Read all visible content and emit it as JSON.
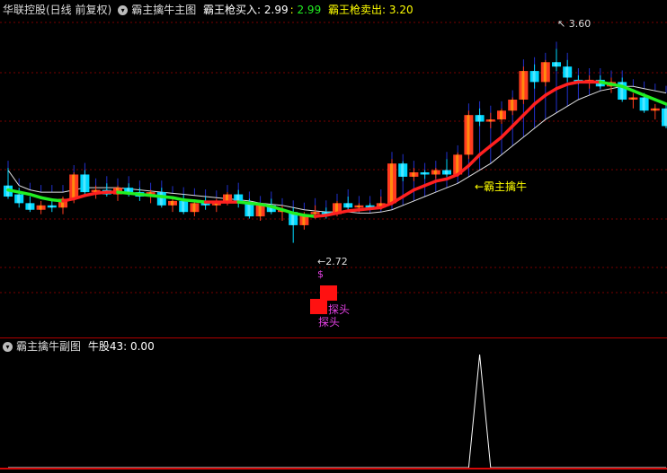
{
  "header": {
    "title": "华联控股(日线 前复权)",
    "indicator_name": "霸主擒牛主图",
    "buy_label": "霸王枪买入",
    "buy_value": "2.99",
    "buy_value2": "2.99",
    "sell_label": "霸王枪卖出",
    "sell_value": "3.20"
  },
  "sub_header": {
    "indicator_name": "霸主擒牛副图",
    "field_label": "牛股43",
    "field_value": "0.00"
  },
  "annotations": {
    "high_price": "3.60",
    "low_price": "2.72",
    "ma_label": "←霸主擒牛",
    "dollar_mark": "$",
    "probe_label_1": "探头",
    "probe_label_2": "探头"
  },
  "colors": {
    "up": "#ff3b1f",
    "down": "#00d8ff",
    "ma_up": "#ff2020",
    "ma_down": "#22ee22",
    "line": "#e0e0e0",
    "grid": "#7a0000",
    "signal": "#ff1111"
  },
  "chart_data": {
    "type": "candlestick",
    "y_range": [
      2.6,
      3.7
    ],
    "candles": [
      {
        "o": 2.98,
        "h": 3.06,
        "l": 2.92,
        "c": 2.93
      },
      {
        "o": 2.94,
        "h": 2.97,
        "l": 2.88,
        "c": 2.9
      },
      {
        "o": 2.9,
        "h": 2.93,
        "l": 2.86,
        "c": 2.87
      },
      {
        "o": 2.87,
        "h": 2.91,
        "l": 2.85,
        "c": 2.89
      },
      {
        "o": 2.89,
        "h": 2.92,
        "l": 2.86,
        "c": 2.88
      },
      {
        "o": 2.88,
        "h": 2.93,
        "l": 2.85,
        "c": 2.92
      },
      {
        "o": 2.92,
        "h": 3.04,
        "l": 2.9,
        "c": 3.03
      },
      {
        "o": 3.03,
        "h": 3.05,
        "l": 2.93,
        "c": 2.95
      },
      {
        "o": 2.95,
        "h": 2.98,
        "l": 2.92,
        "c": 2.96
      },
      {
        "o": 2.96,
        "h": 2.99,
        "l": 2.93,
        "c": 2.94
      },
      {
        "o": 2.94,
        "h": 2.98,
        "l": 2.91,
        "c": 2.97
      },
      {
        "o": 2.97,
        "h": 2.99,
        "l": 2.93,
        "c": 2.95
      },
      {
        "o": 2.95,
        "h": 2.97,
        "l": 2.91,
        "c": 2.93
      },
      {
        "o": 2.93,
        "h": 2.96,
        "l": 2.9,
        "c": 2.95
      },
      {
        "o": 2.95,
        "h": 2.97,
        "l": 2.88,
        "c": 2.89
      },
      {
        "o": 2.89,
        "h": 2.93,
        "l": 2.86,
        "c": 2.91
      },
      {
        "o": 2.91,
        "h": 2.94,
        "l": 2.85,
        "c": 2.86
      },
      {
        "o": 2.86,
        "h": 2.91,
        "l": 2.84,
        "c": 2.9
      },
      {
        "o": 2.9,
        "h": 2.93,
        "l": 2.87,
        "c": 2.89
      },
      {
        "o": 2.89,
        "h": 2.92,
        "l": 2.86,
        "c": 2.91
      },
      {
        "o": 2.91,
        "h": 2.95,
        "l": 2.89,
        "c": 2.94
      },
      {
        "o": 2.94,
        "h": 2.96,
        "l": 2.88,
        "c": 2.9
      },
      {
        "o": 2.9,
        "h": 2.92,
        "l": 2.83,
        "c": 2.84
      },
      {
        "o": 2.84,
        "h": 2.9,
        "l": 2.82,
        "c": 2.89
      },
      {
        "o": 2.89,
        "h": 2.92,
        "l": 2.85,
        "c": 2.86
      },
      {
        "o": 2.86,
        "h": 2.89,
        "l": 2.82,
        "c": 2.87
      },
      {
        "o": 2.86,
        "h": 2.88,
        "l": 2.72,
        "c": 2.8
      },
      {
        "o": 2.8,
        "h": 2.86,
        "l": 2.78,
        "c": 2.85
      },
      {
        "o": 2.85,
        "h": 2.89,
        "l": 2.83,
        "c": 2.86
      },
      {
        "o": 2.86,
        "h": 2.88,
        "l": 2.83,
        "c": 2.85
      },
      {
        "o": 2.85,
        "h": 2.91,
        "l": 2.84,
        "c": 2.9
      },
      {
        "o": 2.9,
        "h": 2.93,
        "l": 2.87,
        "c": 2.88
      },
      {
        "o": 2.88,
        "h": 2.9,
        "l": 2.86,
        "c": 2.89
      },
      {
        "o": 2.89,
        "h": 2.9,
        "l": 2.87,
        "c": 2.88
      },
      {
        "o": 2.88,
        "h": 2.93,
        "l": 2.87,
        "c": 2.9
      },
      {
        "o": 2.9,
        "h": 3.1,
        "l": 2.89,
        "c": 3.08
      },
      {
        "o": 3.08,
        "h": 3.09,
        "l": 3.0,
        "c": 3.02
      },
      {
        "o": 3.02,
        "h": 3.06,
        "l": 3.0,
        "c": 3.04
      },
      {
        "o": 3.04,
        "h": 3.05,
        "l": 3.01,
        "c": 3.03
      },
      {
        "o": 3.03,
        "h": 3.06,
        "l": 3.01,
        "c": 3.05
      },
      {
        "o": 3.05,
        "h": 3.1,
        "l": 3.02,
        "c": 3.03
      },
      {
        "o": 3.03,
        "h": 3.13,
        "l": 3.02,
        "c": 3.12
      },
      {
        "o": 3.12,
        "h": 3.32,
        "l": 3.1,
        "c": 3.3
      },
      {
        "o": 3.3,
        "h": 3.33,
        "l": 3.25,
        "c": 3.27
      },
      {
        "o": 3.27,
        "h": 3.31,
        "l": 3.24,
        "c": 3.28
      },
      {
        "o": 3.28,
        "h": 3.33,
        "l": 3.26,
        "c": 3.32
      },
      {
        "o": 3.32,
        "h": 3.38,
        "l": 3.3,
        "c": 3.37
      },
      {
        "o": 3.37,
        "h": 3.52,
        "l": 3.35,
        "c": 3.5
      },
      {
        "o": 3.5,
        "h": 3.53,
        "l": 3.42,
        "c": 3.45
      },
      {
        "o": 3.45,
        "h": 3.55,
        "l": 3.43,
        "c": 3.54
      },
      {
        "o": 3.54,
        "h": 3.6,
        "l": 3.5,
        "c": 3.52
      },
      {
        "o": 3.52,
        "h": 3.55,
        "l": 3.45,
        "c": 3.47
      },
      {
        "o": 3.46,
        "h": 3.48,
        "l": 3.44,
        "c": 3.45
      },
      {
        "o": 3.45,
        "h": 3.48,
        "l": 3.42,
        "c": 3.46
      },
      {
        "o": 3.46,
        "h": 3.48,
        "l": 3.42,
        "c": 3.43
      },
      {
        "o": 3.43,
        "h": 3.47,
        "l": 3.4,
        "c": 3.45
      },
      {
        "o": 3.45,
        "h": 3.47,
        "l": 3.36,
        "c": 3.37
      },
      {
        "o": 3.37,
        "h": 3.4,
        "l": 3.33,
        "c": 3.38
      },
      {
        "o": 3.38,
        "h": 3.4,
        "l": 3.31,
        "c": 3.32
      },
      {
        "o": 3.32,
        "h": 3.35,
        "l": 3.28,
        "c": 3.33
      },
      {
        "o": 3.33,
        "h": 3.35,
        "l": 3.24,
        "c": 3.25
      }
    ],
    "ma_main": [
      2.96,
      2.95,
      2.94,
      2.925,
      2.915,
      2.91,
      2.92,
      2.935,
      2.945,
      2.95,
      2.95,
      2.945,
      2.94,
      2.935,
      2.93,
      2.925,
      2.915,
      2.91,
      2.905,
      2.905,
      2.905,
      2.905,
      2.9,
      2.895,
      2.885,
      2.87,
      2.855,
      2.845,
      2.84,
      2.845,
      2.855,
      2.865,
      2.87,
      2.875,
      2.88,
      2.9,
      2.93,
      2.96,
      2.98,
      3.0,
      3.01,
      3.03,
      3.07,
      3.12,
      3.16,
      3.2,
      3.25,
      3.3,
      3.35,
      3.39,
      3.42,
      3.44,
      3.45,
      3.45,
      3.45,
      3.44,
      3.43,
      3.41,
      3.39,
      3.37,
      3.35
    ],
    "ma_slow": [
      3.05,
      2.98,
      2.96,
      2.95,
      2.95,
      2.95,
      2.96,
      2.97,
      2.97,
      2.97,
      2.97,
      2.965,
      2.96,
      2.955,
      2.95,
      2.945,
      2.94,
      2.935,
      2.93,
      2.925,
      2.92,
      2.915,
      2.91,
      2.9,
      2.895,
      2.89,
      2.88,
      2.87,
      2.865,
      2.86,
      2.86,
      2.86,
      2.855,
      2.855,
      2.86,
      2.87,
      2.89,
      2.91,
      2.93,
      2.95,
      2.97,
      2.99,
      3.02,
      3.05,
      3.08,
      3.12,
      3.16,
      3.2,
      3.24,
      3.28,
      3.31,
      3.34,
      3.37,
      3.39,
      3.41,
      3.42,
      3.43,
      3.43,
      3.42,
      3.41,
      3.4
    ],
    "sub_series": [
      0,
      0,
      0,
      0,
      0,
      0,
      0,
      0,
      0,
      0,
      0,
      0,
      0,
      0,
      0,
      0,
      0,
      0,
      0,
      0,
      0,
      0,
      0,
      0,
      0,
      0,
      0,
      0,
      0,
      0,
      0,
      0,
      0,
      0,
      0,
      0,
      0,
      0,
      0,
      0,
      0,
      0,
      0,
      43,
      0,
      0,
      0,
      0,
      0,
      0,
      0,
      0,
      0,
      0,
      0,
      0,
      0,
      0,
      0,
      0,
      0
    ]
  }
}
